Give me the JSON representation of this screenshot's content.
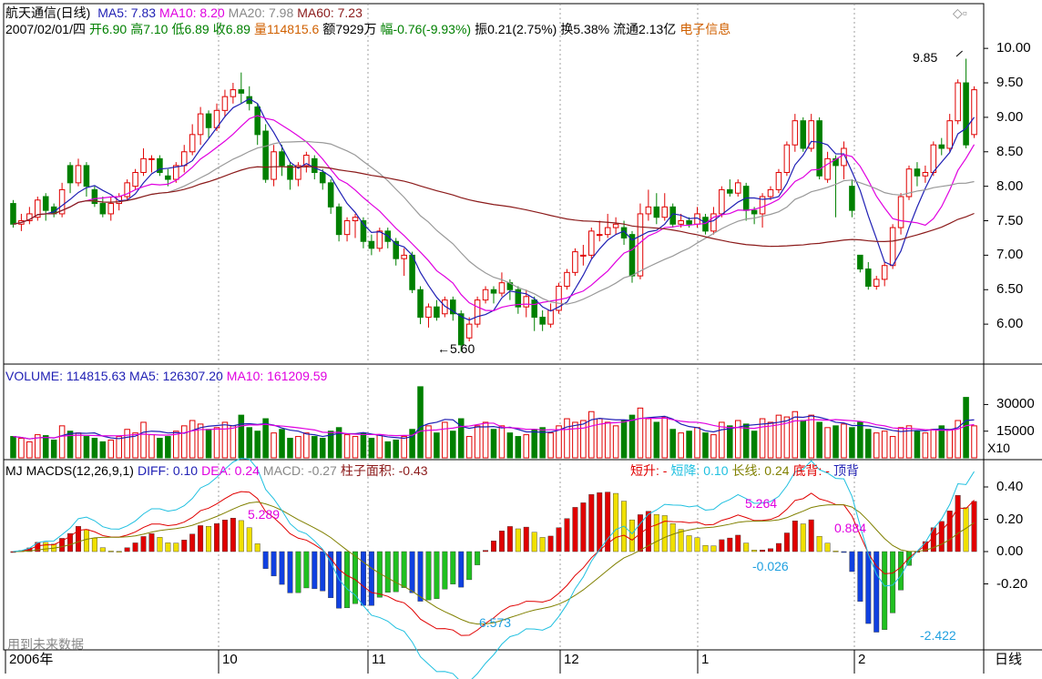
{
  "header": {
    "title": "航天通信(日线)",
    "ma_legend": [
      {
        "text": "MA5: 7.83",
        "color": "#1f1fb4"
      },
      {
        "text": "MA10: 8.20",
        "color": "#e000e0"
      },
      {
        "text": "MA20: 7.98",
        "color": "#888888"
      },
      {
        "text": "MA60: 7.23",
        "color": "#8b1a1a"
      }
    ],
    "quote_parts": [
      {
        "text": "2007/02/01/四",
        "color": "#000000"
      },
      {
        "text": "开6.90",
        "color": "#008000"
      },
      {
        "text": "高7.10",
        "color": "#008000"
      },
      {
        "text": "低6.89",
        "color": "#008000"
      },
      {
        "text": "收6.89",
        "color": "#008000"
      },
      {
        "text": "量114815.6",
        "color": "#d06000"
      },
      {
        "text": "额7929万",
        "color": "#000000"
      },
      {
        "text": "幅-0.76(-9.93%)",
        "color": "#008000"
      },
      {
        "text": "振0.21(2.75%)",
        "color": "#000000"
      },
      {
        "text": "换5.38%",
        "color": "#000000"
      },
      {
        "text": "流通2.13亿",
        "color": "#000000"
      },
      {
        "text": "电子信息",
        "color": "#d06000"
      }
    ]
  },
  "price_axis": [
    "10.00",
    "9.50",
    "9.00",
    "8.50",
    "8.00",
    "7.50",
    "7.00",
    "6.50",
    "6.00"
  ],
  "price_annotations": {
    "high": "9.85",
    "low": "5.60"
  },
  "volume": {
    "legend": [
      {
        "text": "VOLUME: 114815.63",
        "color": "#1f1fb4"
      },
      {
        "text": "MA5: 126307.20",
        "color": "#1f1fb4"
      },
      {
        "text": "MA10: 161209.59",
        "color": "#e000e0"
      }
    ],
    "axis": [
      "30000",
      "15000"
    ],
    "unit": "X10"
  },
  "macd": {
    "legend": [
      {
        "text": "MJ",
        "color": "#000000"
      },
      {
        "text": "MACDS(12,26,9,1)",
        "color": "#000000"
      },
      {
        "text": "DIFF: 0.10",
        "color": "#1f1fb4"
      },
      {
        "text": "DEA: 0.24",
        "color": "#e000e0"
      },
      {
        "text": "MACD: -0.27",
        "color": "#888888"
      },
      {
        "text": "柱子面积: -0.43",
        "color": "#8b1a1a"
      }
    ],
    "legend_right": [
      {
        "text": "短升: -",
        "color": "#e00000"
      },
      {
        "text": "短降: 0.10",
        "color": "#20c0e0"
      },
      {
        "text": "长线: 0.24",
        "color": "#808000"
      },
      {
        "text": "底背: -",
        "color": "#e00000"
      },
      {
        "text": "顶背",
        "color": "#1f1fb4"
      }
    ],
    "axis": [
      "0.40",
      "0.20",
      "0.00",
      "-0.20"
    ],
    "annotations": [
      "5.289",
      "5.264",
      "0.884",
      "-0.026",
      "6.573",
      "-2.422"
    ],
    "watermark": "用到未来数据"
  },
  "x_axis": {
    "labels": [
      "2006年",
      "10",
      "11",
      "12",
      "1",
      "2"
    ],
    "period": "日线"
  },
  "colors": {
    "up": "#e00000",
    "down": "#008000",
    "ma5": "#1f1fb4",
    "ma10": "#e000e0",
    "ma20": "#999999",
    "ma60": "#8b1a1a",
    "macd_red": "#e00000",
    "macd_yellow": "#f0e000",
    "macd_blue": "#1040e0",
    "macd_green": "#20c020"
  },
  "chart_data": {
    "type": "candlestick",
    "price_range": [
      5.5,
      10.2
    ],
    "candles": [
      [
        7.75,
        7.45,
        7.8,
        7.4
      ],
      [
        7.45,
        7.5,
        7.6,
        7.35
      ],
      [
        7.5,
        7.6,
        7.7,
        7.45
      ],
      [
        7.55,
        7.8,
        7.85,
        7.5
      ],
      [
        7.85,
        7.65,
        7.9,
        7.5
      ],
      [
        7.7,
        7.6,
        7.75,
        7.55
      ],
      [
        7.6,
        7.95,
        8.05,
        7.55
      ],
      [
        8.3,
        8.05,
        8.35,
        7.9
      ],
      [
        8.05,
        8.3,
        8.4,
        8.0
      ],
      [
        8.3,
        8.0,
        8.35,
        7.85
      ],
      [
        7.95,
        7.75,
        8.0,
        7.7
      ],
      [
        7.75,
        7.6,
        7.85,
        7.55
      ],
      [
        7.6,
        7.75,
        7.85,
        7.5
      ],
      [
        7.75,
        7.85,
        7.9,
        7.65
      ],
      [
        7.85,
        8.05,
        8.1,
        7.8
      ],
      [
        8.0,
        8.2,
        8.25,
        7.95
      ],
      [
        8.2,
        8.4,
        8.55,
        8.15
      ],
      [
        8.4,
        8.4,
        8.45,
        8.2
      ],
      [
        8.4,
        8.2,
        8.45,
        8.15
      ],
      [
        8.15,
        8.1,
        8.25,
        8.0
      ],
      [
        8.1,
        8.3,
        8.35,
        8.05
      ],
      [
        8.3,
        8.5,
        8.6,
        8.2
      ],
      [
        8.5,
        8.75,
        8.9,
        8.45
      ],
      [
        8.75,
        9.05,
        9.15,
        8.6
      ],
      [
        9.05,
        8.85,
        9.1,
        8.7
      ],
      [
        8.85,
        9.1,
        9.2,
        8.8
      ],
      [
        9.1,
        9.3,
        9.4,
        9.0
      ],
      [
        9.3,
        9.4,
        9.5,
        9.2
      ],
      [
        9.4,
        9.35,
        9.65,
        9.2
      ],
      [
        9.3,
        9.2,
        9.45,
        9.1
      ],
      [
        9.15,
        8.75,
        9.2,
        8.6
      ],
      [
        8.8,
        8.1,
        8.9,
        8.05
      ],
      [
        8.1,
        8.5,
        8.6,
        8.0
      ],
      [
        8.5,
        8.3,
        8.6,
        8.15
      ],
      [
        8.3,
        8.1,
        8.35,
        7.95
      ],
      [
        8.1,
        8.3,
        8.35,
        8.0
      ],
      [
        8.3,
        8.45,
        8.5,
        8.2
      ],
      [
        8.4,
        8.2,
        8.45,
        8.1
      ],
      [
        8.2,
        8.05,
        8.25,
        7.95
      ],
      [
        8.05,
        7.7,
        8.1,
        7.6
      ],
      [
        7.7,
        7.3,
        7.75,
        7.2
      ],
      [
        7.3,
        7.5,
        7.55,
        7.2
      ],
      [
        7.5,
        7.55,
        7.6,
        7.25
      ],
      [
        7.5,
        7.2,
        7.55,
        7.1
      ],
      [
        7.2,
        7.1,
        7.3,
        7.0
      ],
      [
        7.1,
        7.35,
        7.4,
        7.05
      ],
      [
        7.35,
        7.2,
        7.4,
        7.1
      ],
      [
        7.2,
        6.95,
        7.25,
        6.85
      ],
      [
        6.95,
        7.0,
        7.1,
        6.7
      ],
      [
        7.0,
        6.5,
        7.05,
        6.45
      ],
      [
        6.5,
        6.1,
        6.55,
        6.0
      ],
      [
        6.1,
        6.25,
        6.3,
        5.95
      ],
      [
        6.25,
        6.1,
        6.35,
        6.05
      ],
      [
        6.15,
        6.35,
        6.4,
        6.1
      ],
      [
        6.35,
        6.15,
        6.4,
        6.05
      ],
      [
        6.15,
        5.7,
        6.2,
        5.6
      ],
      [
        5.8,
        6.0,
        6.1,
        5.75
      ],
      [
        6.0,
        6.35,
        6.4,
        5.95
      ],
      [
        6.35,
        6.5,
        6.55,
        6.3
      ],
      [
        6.5,
        6.45,
        6.55,
        6.3
      ],
      [
        6.45,
        6.6,
        6.75,
        6.4
      ],
      [
        6.6,
        6.5,
        6.65,
        6.35
      ],
      [
        6.5,
        6.25,
        6.55,
        6.15
      ],
      [
        6.25,
        6.4,
        6.5,
        6.1
      ],
      [
        6.35,
        6.1,
        6.4,
        5.9
      ],
      [
        6.1,
        6.0,
        6.2,
        5.9
      ],
      [
        6.0,
        6.2,
        6.3,
        5.95
      ],
      [
        6.2,
        6.55,
        6.6,
        6.15
      ],
      [
        6.55,
        6.75,
        6.8,
        6.5
      ],
      [
        6.75,
        7.05,
        7.1,
        6.7
      ],
      [
        7.0,
        7.0,
        7.15,
        6.85
      ],
      [
        7.0,
        7.35,
        7.4,
        6.95
      ],
      [
        7.3,
        7.3,
        7.5,
        7.2
      ],
      [
        7.3,
        7.4,
        7.6,
        7.25
      ],
      [
        7.4,
        7.45,
        7.55,
        7.3
      ],
      [
        7.4,
        7.25,
        7.5,
        7.15
      ],
      [
        7.3,
        6.7,
        7.35,
        6.6
      ],
      [
        6.7,
        7.6,
        7.75,
        6.65
      ],
      [
        7.6,
        7.7,
        7.95,
        7.5
      ],
      [
        7.7,
        7.55,
        7.9,
        7.45
      ],
      [
        7.55,
        7.7,
        7.9,
        7.5
      ],
      [
        7.7,
        7.45,
        7.75,
        7.4
      ],
      [
        7.45,
        7.5,
        7.6,
        7.4
      ],
      [
        7.5,
        7.45,
        7.55,
        7.4
      ],
      [
        7.45,
        7.6,
        7.7,
        7.4
      ],
      [
        7.55,
        7.35,
        7.6,
        7.3
      ],
      [
        7.35,
        7.6,
        7.7,
        7.3
      ],
      [
        7.6,
        7.95,
        8.0,
        7.55
      ],
      [
        7.95,
        7.9,
        8.1,
        7.85
      ],
      [
        7.9,
        8.05,
        8.1,
        7.85
      ],
      [
        8.0,
        7.65,
        8.05,
        7.5
      ],
      [
        7.65,
        7.6,
        7.7,
        7.45
      ],
      [
        7.6,
        7.85,
        7.9,
        7.4
      ],
      [
        7.85,
        7.95,
        8.0,
        7.8
      ],
      [
        7.95,
        8.2,
        8.25,
        7.9
      ],
      [
        8.2,
        8.6,
        8.65,
        8.15
      ],
      [
        8.6,
        8.95,
        9.05,
        8.5
      ],
      [
        8.95,
        8.55,
        9.0,
        8.5
      ],
      [
        8.55,
        8.95,
        9.05,
        8.5
      ],
      [
        8.95,
        8.15,
        9.0,
        8.1
      ],
      [
        8.1,
        8.4,
        8.5,
        8.05
      ],
      [
        8.4,
        8.3,
        8.45,
        7.55
      ],
      [
        8.3,
        8.55,
        8.65,
        8.1
      ],
      [
        8.0,
        7.65,
        8.1,
        7.55
      ],
      [
        7.0,
        6.8,
        7.0,
        6.75
      ],
      [
        6.8,
        6.55,
        6.9,
        6.5
      ],
      [
        6.55,
        6.65,
        6.7,
        6.5
      ],
      [
        6.65,
        6.85,
        6.9,
        6.55
      ],
      [
        6.85,
        7.4,
        7.45,
        6.8
      ],
      [
        7.4,
        7.85,
        7.9,
        7.3
      ],
      [
        7.85,
        8.25,
        8.3,
        7.8
      ],
      [
        8.25,
        8.15,
        8.35,
        8.0
      ],
      [
        8.15,
        8.2,
        8.3,
        8.05
      ],
      [
        8.2,
        8.6,
        8.65,
        8.15
      ],
      [
        8.6,
        8.55,
        8.7,
        8.45
      ],
      [
        8.55,
        8.95,
        9.05,
        8.5
      ],
      [
        8.95,
        9.5,
        9.55,
        8.9
      ],
      [
        9.5,
        8.6,
        9.85,
        8.55
      ],
      [
        8.75,
        9.4,
        9.45,
        8.7
      ]
    ],
    "volumes": [
      12000,
      11000,
      9000,
      13000,
      12500,
      10000,
      18000,
      15000,
      14000,
      12000,
      11000,
      9000,
      10000,
      12000,
      16000,
      14000,
      20000,
      13000,
      11000,
      12000,
      15000,
      18000,
      21000,
      19000,
      16000,
      17000,
      20000,
      18000,
      24000,
      17000,
      15000,
      22000,
      14000,
      16000,
      11000,
      12000,
      14000,
      12000,
      11000,
      15000,
      17000,
      13000,
      12000,
      14000,
      11000,
      13000,
      9000,
      10000,
      12000,
      16000,
      40000,
      18000,
      14000,
      20000,
      15000,
      22000,
      12000,
      18000,
      20000,
      16000,
      18000,
      14000,
      12000,
      13000,
      16000,
      17000,
      14000,
      18000,
      22000,
      20000,
      21000,
      26000,
      22000,
      20000,
      18000,
      21000,
      24000,
      28000,
      22000,
      20000,
      23000,
      16000,
      14000,
      15000,
      17000,
      14000,
      13000,
      20000,
      18000,
      21000,
      19000,
      15000,
      22000,
      20000,
      24000,
      23000,
      26000,
      21000,
      24000,
      20000,
      17000,
      18000,
      19000,
      17000,
      20000,
      16000,
      14000,
      15000,
      12000,
      17000,
      18000,
      15000,
      14000,
      16000,
      18000,
      16000,
      21000,
      34000,
      18000
    ]
  }
}
